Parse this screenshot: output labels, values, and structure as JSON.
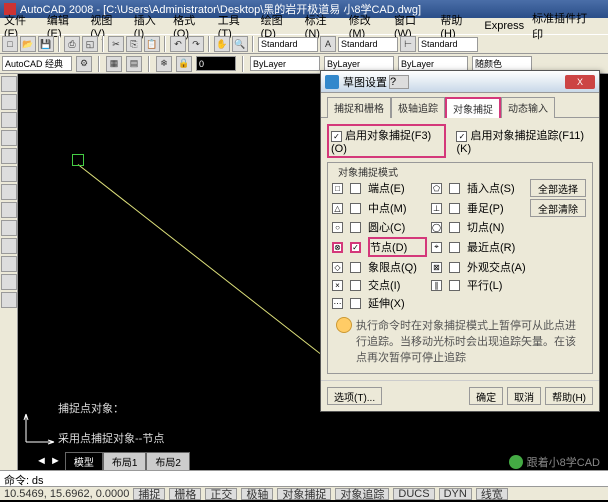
{
  "title": "AutoCAD 2008 - [C:\\Users\\Administrator\\Desktop\\黑的岩开极道易 小8学CAD.dwg]",
  "menu": {
    "file": "文件(F)",
    "edit": "编辑(E)",
    "view": "视图(V)",
    "insert": "插入(I)",
    "format": "格式(O)",
    "tools": "工具(T)",
    "draw": "绘图(D)",
    "dim": "标注(N)",
    "modify": "修改(M)",
    "window": "窗口(W)",
    "help": "帮助(H)",
    "express": "Express",
    "other": "标准插件打印"
  },
  "toolbar2": {
    "ws": "AutoCAD 经典",
    "layer": "ByLayer",
    "layer2": "ByLayer",
    "layer3": "ByLayer",
    "color": "随颜色",
    "std1": "Standard",
    "std2": "Standard",
    "std3": "Standard"
  },
  "canvas": {
    "caption_l1": "捕捉点对象：",
    "caption_l2": "采用点捕捉对象--节点"
  },
  "tabs": {
    "model": "模型",
    "l1": "布局1",
    "l2": "布局2"
  },
  "cmd": {
    "prompt": "命令:",
    "value": "ds"
  },
  "status": {
    "coords": "10.5469, 15.6962, 0.0000",
    "snap": "捕捉",
    "grid": "栅格",
    "ortho": "正交",
    "polar": "极轴",
    "osnap": "对象捕捉",
    "otrack": "对象追踪",
    "ducs": "DUCS",
    "dyn": "DYN",
    "lwt": "线宽"
  },
  "watermark": "跟着小8学CAD",
  "dialog": {
    "title": "草图设置",
    "tabs": {
      "t1": "捕捉和栅格",
      "t2": "极轴追踪",
      "t3": "对象捕捉",
      "t4": "动态输入"
    },
    "enable_osnap": "启用对象捕捉(F3)(O)",
    "enable_otrack": "启用对象捕捉追踪(F11)(K)",
    "mode_label": "对象捕捉模式",
    "snaps": {
      "endpoint": "端点(E)",
      "insert": "插入点(S)",
      "midpoint": "中点(M)",
      "perp": "垂足(P)",
      "center": "圆心(C)",
      "tangent": "切点(N)",
      "node": "节点(D)",
      "nearest": "最近点(R)",
      "quadrant": "象限点(Q)",
      "appint": "外观交点(A)",
      "intersect": "交点(I)",
      "parallel": "平行(L)",
      "extension": "延伸(X)"
    },
    "btn_all": "全部选择",
    "btn_clear": "全部清除",
    "tip": "执行命令时在对象捕捉模式上暂停可从此点进行追踪。当移动光标时会出现追踪矢量。在该点再次暂停可停止追踪",
    "options": "选项(T)...",
    "ok": "确定",
    "cancel": "取消",
    "help": "帮助(H)"
  }
}
